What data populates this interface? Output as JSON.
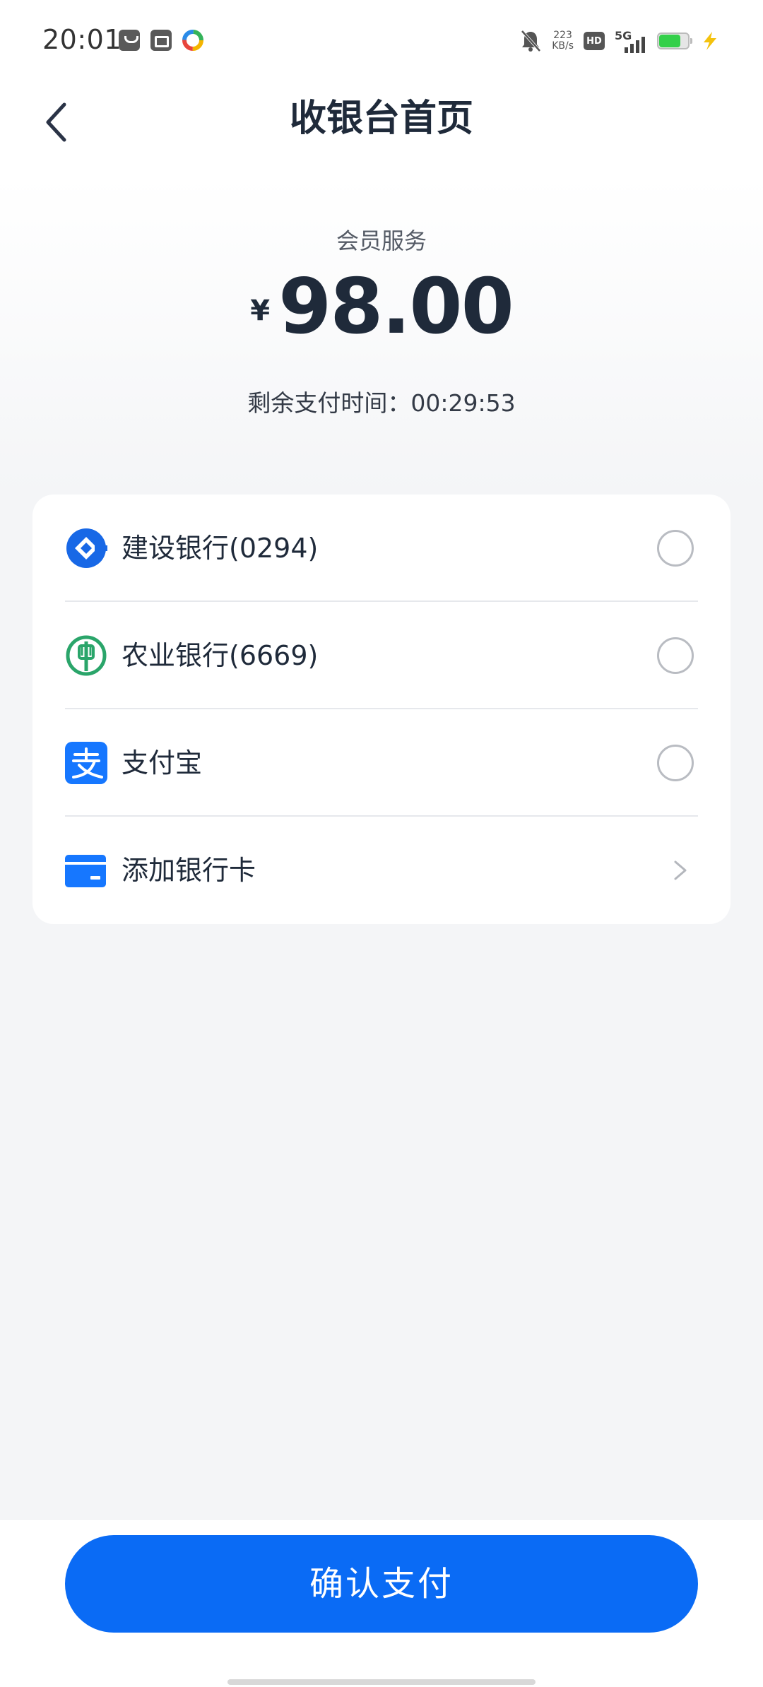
{
  "status_bar": {
    "time": "20:01",
    "net_speed_value": "223",
    "net_speed_unit": "KB/s",
    "hd_label": "HD",
    "network_type": "5G",
    "battery_level": 0.75
  },
  "header": {
    "title": "收银台首页"
  },
  "order": {
    "name": "会员服务",
    "currency_symbol": "¥",
    "amount": "98.00",
    "timer_label": "剩余支付时间：",
    "timer_value": "00:29:53"
  },
  "payment_methods": [
    {
      "label": "建设银行(0294)",
      "icon": "ccb-bank-icon",
      "selected": false
    },
    {
      "label": "农业银行(6669)",
      "icon": "abc-bank-icon",
      "selected": false
    },
    {
      "label": "支付宝",
      "icon": "alipay-icon",
      "selected": false
    },
    {
      "label": "添加银行卡",
      "icon": "bank-card-icon"
    }
  ],
  "actions": {
    "confirm_label": "确认支付"
  },
  "colors": {
    "accent": "#0a6bf5",
    "ccb_blue": "#1868e6",
    "abc_green": "#2aa56a",
    "alipay_blue": "#1677ff",
    "title_text": "#1f2a3a"
  }
}
